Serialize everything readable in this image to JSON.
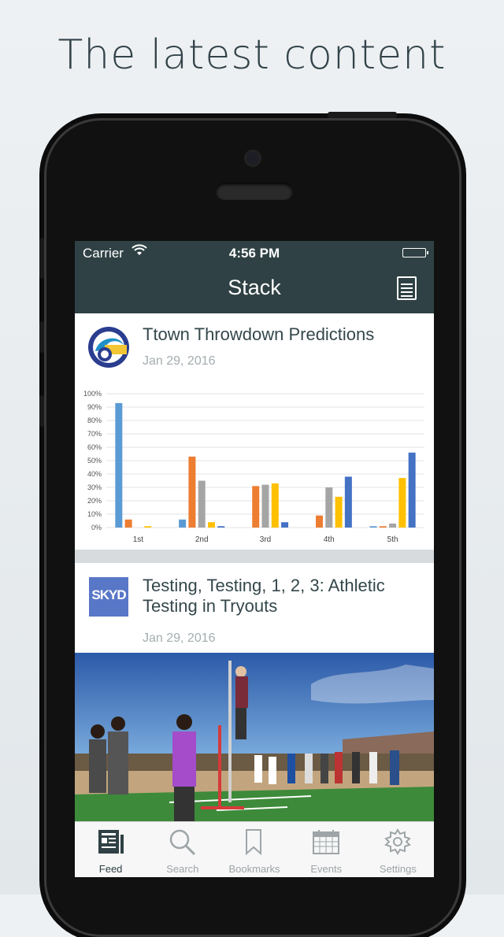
{
  "headline": "The latest content",
  "status_bar": {
    "carrier": "Carrier",
    "time": "4:56 PM"
  },
  "nav": {
    "title": "Stack",
    "menu_icon": "list-icon"
  },
  "feed": [
    {
      "title": "Ttown Throwdown Predictions",
      "date": "Jan 29, 2016",
      "thumb": "ttown-logo"
    },
    {
      "title": "Testing, Testing, 1, 2, 3: Athletic Testing in Tryouts",
      "date": "Jan 29, 2016",
      "thumb": "skyd-logo",
      "logo_text": "SKYD"
    }
  ],
  "chart_data": {
    "type": "bar",
    "categories": [
      "1st",
      "2nd",
      "3rd",
      "4th",
      "5th"
    ],
    "ylim": [
      0,
      100
    ],
    "ytick_labels": [
      "0%",
      "10%",
      "20%",
      "30%",
      "40%",
      "50%",
      "60%",
      "70%",
      "80%",
      "90%",
      "100%"
    ],
    "series": [
      {
        "color": "#5b9bd5",
        "values": [
          93,
          6,
          0,
          0,
          1
        ]
      },
      {
        "color": "#ed7d31",
        "values": [
          6,
          53,
          31,
          9,
          1
        ]
      },
      {
        "color": "#a5a5a5",
        "values": [
          0,
          35,
          32,
          30,
          3
        ]
      },
      {
        "color": "#ffc000",
        "values": [
          1,
          4,
          33,
          23,
          37
        ]
      },
      {
        "color": "#4472c4",
        "values": [
          0,
          1,
          4,
          38,
          56
        ]
      }
    ]
  },
  "tabs": [
    {
      "label": "Feed",
      "icon": "newspaper-icon",
      "active": true
    },
    {
      "label": "Search",
      "icon": "search-icon",
      "active": false
    },
    {
      "label": "Bookmarks",
      "icon": "bookmark-icon",
      "active": false
    },
    {
      "label": "Events",
      "icon": "calendar-icon",
      "active": false
    },
    {
      "label": "Settings",
      "icon": "gear-icon",
      "active": false
    }
  ]
}
